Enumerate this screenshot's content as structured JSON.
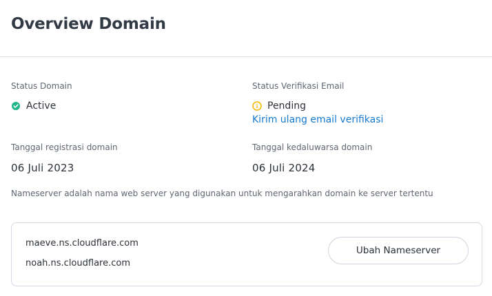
{
  "header": {
    "title": "Overview Domain"
  },
  "status_domain": {
    "label": "Status Domain",
    "value": "Active",
    "icon": "check-circle-icon",
    "color": "#22b58c"
  },
  "email_verification": {
    "label": "Status Verifikasi Email",
    "value": "Pending",
    "icon": "info-circle-icon",
    "color": "#f4b400",
    "resend_link": "Kirim ulang email verifikasi"
  },
  "registration": {
    "label": "Tanggal registrasi domain",
    "value": "06 Juli 2023"
  },
  "expiration": {
    "label": "Tanggal kedaluwarsa domain",
    "value": "06 Juli 2024"
  },
  "nameserver": {
    "description": "Nameserver adalah nama web server yang digunakan untuk mengarahkan domain ke server tertentu",
    "items": [
      "maeve.ns.cloudflare.com",
      "noah.ns.cloudflare.com"
    ],
    "button_label": "Ubah Nameserver"
  },
  "colors": {
    "link": "#1479d1",
    "success": "#22b58c",
    "warning": "#f4b400"
  }
}
